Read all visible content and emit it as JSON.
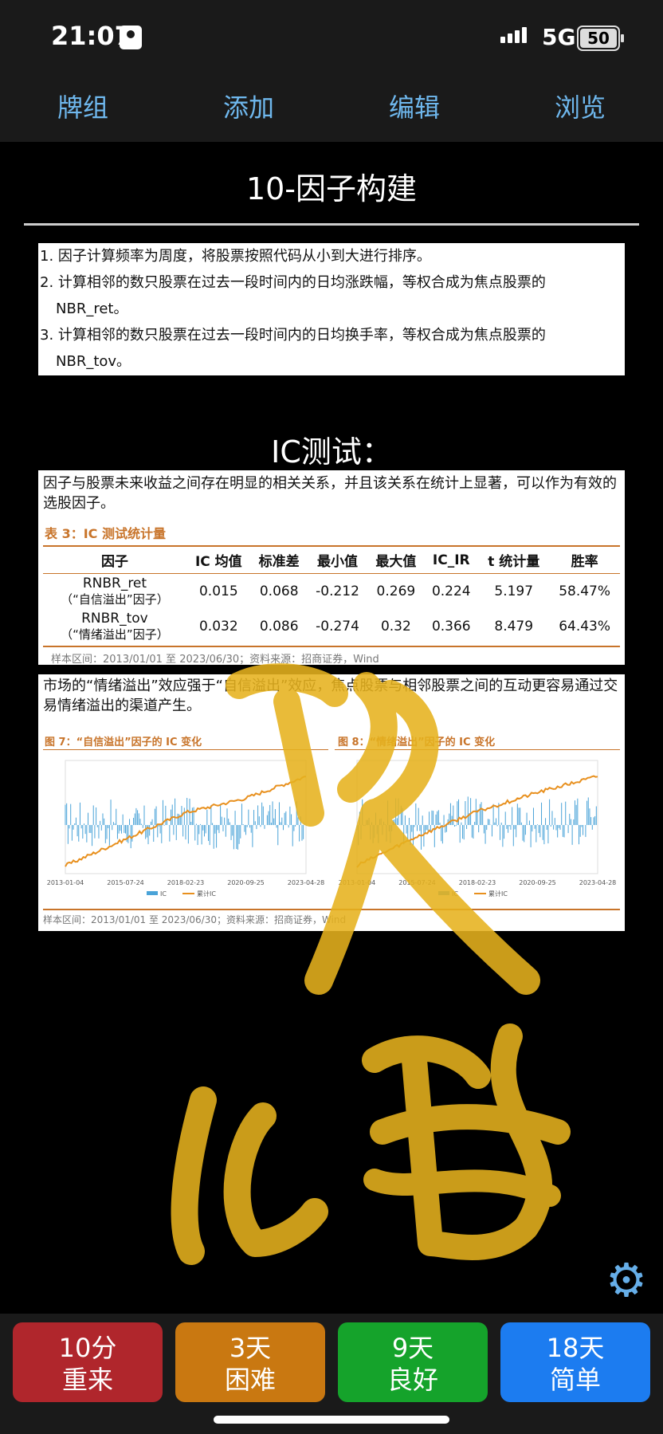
{
  "status": {
    "time": "21:07",
    "network": "5G",
    "battery": "50"
  },
  "nav": {
    "decks": "牌组",
    "add": "添加",
    "edit": "编辑",
    "browse": "浏览"
  },
  "card": {
    "title": "10-因子构建",
    "steps": [
      "1. 因子计算频率为周度，将股票按照代码从小到大进行排序。",
      "2. 计算相邻的数只股票在过去一段时间内的日均涨跌幅，等权合成为焦点股票的",
      "NBR_ret。",
      "3. 计算相邻的数只股票在过去一段时间内的日均换手率，等权合成为焦点股票的",
      "NBR_tov。"
    ],
    "ic_heading": "IC测试：",
    "ic_desc": "因子与股票未来收益之间存在明显的相关关系，并且该关系在统计上显著，可以作为有效的选股因子。",
    "table": {
      "caption": "表 3：IC 测试统计量",
      "headers": [
        "因子",
        "IC 均值",
        "标准差",
        "最小值",
        "最大值",
        "IC_IR",
        "t 统计量",
        "胜率"
      ],
      "rows": [
        {
          "name": "RNBR_ret",
          "sub": "（“自信溢出”因子）",
          "values": [
            "0.015",
            "0.068",
            "-0.212",
            "0.269",
            "0.224",
            "5.197",
            "58.47%"
          ]
        },
        {
          "name": "RNBR_tov",
          "sub": "（“情绪溢出”因子）",
          "values": [
            "0.032",
            "0.086",
            "-0.274",
            "0.32",
            "0.366",
            "8.479",
            "64.43%"
          ]
        }
      ],
      "source": "样本区间：2013/01/01 至 2023/06/30；资料来源：招商证券，Wind"
    },
    "spill_desc": "市场的“情绪溢出”效应强于“自信溢出”效应，焦点股票与相邻股票之间的互动更容易通过交易情绪溢出的渠道产生。",
    "fig7_caption": "图 7：“自信溢出”因子的 IC 变化",
    "fig8_caption": "图 8：“情绪溢出”因子的 IC 变化",
    "fig_source": "样本区间：2013/01/01 至 2023/06/30；资料来源：招商证券，Wind"
  },
  "chart_data": [
    {
      "type": "line",
      "title": "图 7：“自信溢出”因子的 IC 变化",
      "x": [
        "2013-01-04",
        "2015-07-24",
        "2018-02-23",
        "2020-09-25",
        "2023-04-28"
      ],
      "series": [
        {
          "name": "IC",
          "values": [
            0.05,
            -0.1,
            0.12,
            -0.05,
            0.08
          ]
        },
        {
          "name": "累计IC",
          "values": [
            0.0,
            2.2,
            4.4,
            5.6,
            7.4
          ]
        }
      ],
      "ylim_right": [
        -0.3,
        0.3
      ]
    },
    {
      "type": "line",
      "title": "图 8：“情绪溢出”因子的 IC 变化",
      "x": [
        "2013-01-04",
        "2015-07-24",
        "2018-02-23",
        "2020-09-25",
        "2023-04-28"
      ],
      "series": [
        {
          "name": "IC",
          "values": [
            0.1,
            -0.05,
            0.15,
            0.0,
            0.12
          ]
        },
        {
          "name": "累计IC",
          "values": [
            -0.25,
            -0.05,
            0.12,
            0.25,
            0.36
          ]
        }
      ],
      "ylim": [
        -0.4,
        0.4
      ]
    }
  ],
  "answers": [
    {
      "time": "10分",
      "label": "重来",
      "color": "#b0262c"
    },
    {
      "time": "3天",
      "label": "困难",
      "color": "#c97811"
    },
    {
      "time": "9天",
      "label": "良好",
      "color": "#15a32b"
    },
    {
      "time": "18天",
      "label": "简单",
      "color": "#1c7cf0"
    }
  ]
}
